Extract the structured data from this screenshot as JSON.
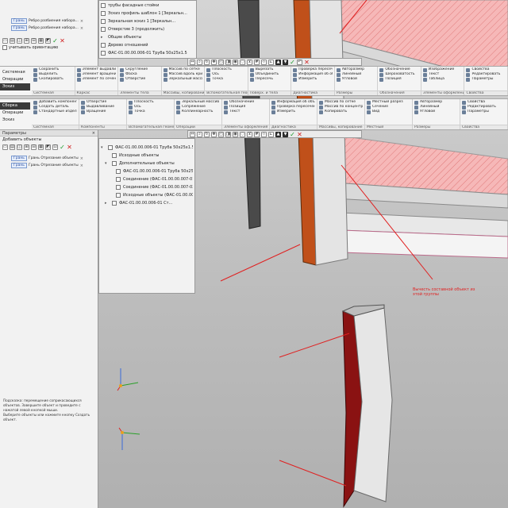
{
  "app": {
    "accent": "#2f5da8"
  },
  "top_tree": {
    "rows": [
      {
        "label": "трубы фасадные стойки",
        "icon": "pipe-icon"
      },
      {
        "label": "Эскиз профиль шаблон 1 [Зеркальн...",
        "icon": "sketch-icon"
      },
      {
        "label": "Зеркальная эскиз 1 [Зеркальн...",
        "icon": "mirror-icon"
      },
      {
        "label": "Отверстие 3 (продолжить)",
        "icon": "hole-icon"
      },
      {
        "label": "Общие объекты",
        "icon": "folder-icon"
      },
      {
        "label": "Дерево отношений",
        "icon": "tree-icon"
      },
      {
        "label": "ФАС-01.00.00.006-01 Труба 50х25х1.5",
        "icon": "part-icon"
      }
    ]
  },
  "top_left": {
    "chips": [
      "Грань",
      "Грань"
    ],
    "chip_text": [
      "Ребро разбиения набора...",
      "Ребро разбиения набора..."
    ],
    "search_label": "учитывать ориентацию"
  },
  "ribbon1": {
    "tabs": [
      "Системная",
      "Операции",
      "Эскиз"
    ],
    "groups": [
      "Системная",
      "Каркас",
      "Элементы тела",
      "Массивы, копирование",
      "Вспомогательная геометрия",
      "Поверх. и тела",
      "Диагностика",
      "Размеры",
      "Обозначения",
      "Элементы оформления",
      "Свойства"
    ],
    "columns": [
      [
        "Сохранить",
        "Выделить",
        "Скопировать"
      ],
      [
        "Элемент выдавливания",
        "Элемент вращения",
        "Элемент по сечениям"
      ],
      [
        "Скругление",
        "Фаска",
        "Отверстие"
      ],
      [
        "Массив по сетке",
        "Массив вдоль кривой",
        "Зеркальный массив"
      ],
      [
        "Плоскость",
        "Ось",
        "Точка"
      ],
      [
        "Вырезать",
        "Объединить",
        "Пересечь"
      ],
      [
        "Проверка пересечений",
        "Информация об объекте",
        "Измерить"
      ],
      [
        "Авторазмер",
        "Линейный",
        "Угловой"
      ],
      [
        "Обозначение",
        "Шероховатость",
        "Позиция"
      ],
      [
        "Изображение",
        "Текст",
        "Таблица"
      ],
      [
        "Свойства",
        "Редактировать",
        "Параметры"
      ]
    ]
  },
  "ribbon2": {
    "tabs": [
      "Сборка",
      "Операции",
      "Эскиз"
    ],
    "groups": [
      "Системная",
      "Компоненты",
      "Вспомогательная геометрия",
      "Операции",
      "Элементы оформления",
      "Диагностика",
      "Массивы, копирование",
      "Местный",
      "Размеры",
      "Свойства"
    ],
    "columns": [
      [
        "Добавить компонент",
        "Создать деталь",
        "Стандартные изделия"
      ],
      [
        "Отверстие",
        "Выдавливание",
        "Вращение"
      ],
      [
        "Плоскость",
        "Ось",
        "Точка"
      ],
      [
        "Зеркальный массив",
        "Сопряжение",
        "Коллинеарность"
      ],
      [
        "Обозначение",
        "Позиция",
        "Текст"
      ],
      [
        "Информация об объекте",
        "Проверка пересечений",
        "Измерить"
      ],
      [
        "Массив по сетке",
        "Массив по концентрической сетке",
        "Копировать"
      ],
      [
        "Местный разрез",
        "Сечение",
        "Вид"
      ],
      [
        "Авторазмер",
        "Линейный",
        "Угловой"
      ],
      [
        "Свойства",
        "Редактировать",
        "Параметры"
      ]
    ]
  },
  "mid_left": {
    "panel_title": "Параметры",
    "subtitle": "Добавить объекты",
    "chips": [
      "Грань",
      "Грань"
    ],
    "chip_text": [
      "Грань Отрезание объекты",
      "Грань Отрезание объекты"
    ]
  },
  "tree_panel": {
    "rows": [
      {
        "label": "ФАС-01.00.00.006-01 Труба 50х25х1.5 (1)",
        "indent": 0,
        "toggle": "▾"
      },
      {
        "label": "Исходные объекты",
        "indent": 1,
        "toggle": ""
      },
      {
        "label": "Дополнительные объекты",
        "indent": 1,
        "toggle": "▾"
      },
      {
        "label": "ФАС-01.00.00.006-01 Труба 50х25х1.5",
        "indent": 2,
        "toggle": ""
      },
      {
        "label": "Соединение (ФАС-01.00.00.007-01 Труба 50х...",
        "indent": 2,
        "toggle": ""
      },
      {
        "label": "Соединение (ФАС-01.00.00.007-02 Труба 50х...",
        "indent": 2,
        "toggle": ""
      },
      {
        "label": "Исходные объекты (ФАС-01.00.00.006-01 Труба 50...",
        "indent": 2,
        "toggle": ""
      },
      {
        "label": "ФАС-01.00.00.006-01 Ст...",
        "indent": 1,
        "toggle": "▸"
      }
    ]
  },
  "messages": [
    "Подсказка: перемещение соприкасающихся объектов. Завершите объект и проведите с нажатой левой кнопкой мыши.",
    "Выберите объекты или нажмите кнопку Создать объект."
  ],
  "annotation": {
    "text": [
      "Вычесть составной объект из",
      "этой группы"
    ]
  },
  "colors": {
    "pipe_red": "#8a1212",
    "pipe_orange": "#c0501a",
    "hatch": "#f2a6a6",
    "leader": "#e02020"
  }
}
